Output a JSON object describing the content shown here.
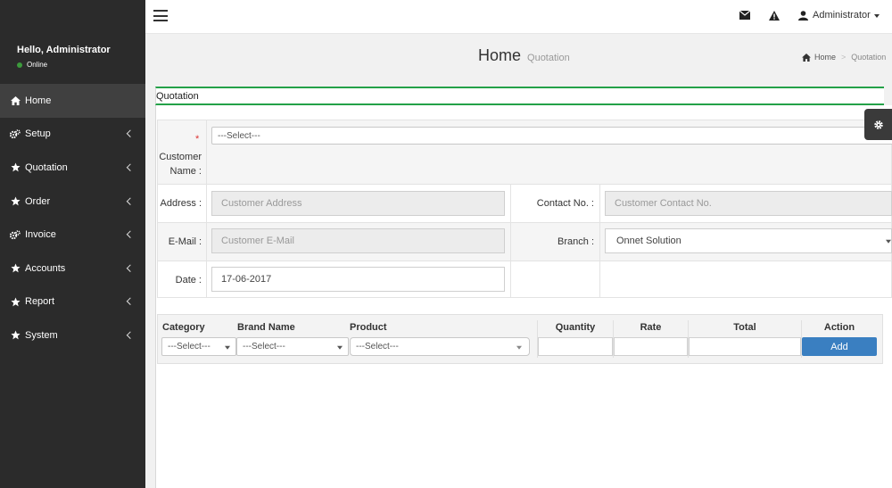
{
  "sidebar": {
    "greeting": "Hello, Administrator",
    "status": "Online",
    "status_color": "#3c9a3c",
    "items": [
      {
        "label": "Home",
        "icon": "home-icon",
        "active": true
      },
      {
        "label": "Setup",
        "icon": "cogs-icon"
      },
      {
        "label": "Quotation",
        "icon": "star-icon"
      },
      {
        "label": "Order",
        "icon": "star-icon"
      },
      {
        "label": "Invoice",
        "icon": "cogs-icon"
      },
      {
        "label": "Accounts",
        "icon": "star-icon"
      },
      {
        "label": "Report",
        "icon": "star-icon"
      },
      {
        "label": "System",
        "icon": "star-icon"
      }
    ]
  },
  "topbar": {
    "user": "Administrator"
  },
  "header": {
    "title": "Home",
    "subtitle": "Quotation",
    "breadcrumb": [
      "Home",
      "Quotation"
    ]
  },
  "box": {
    "title": "Quotation",
    "accent_color": "#24a148"
  },
  "form": {
    "customer_name_label_1": "Customer",
    "customer_name_label_2": "Name :",
    "customer_select": "---Select---",
    "address_label": "Address :",
    "address_placeholder": "Customer Address",
    "contact_label": "Contact No. :",
    "contact_placeholder": "Customer Contact No.",
    "email_label": "E-Mail :",
    "email_placeholder": "Customer E-Mail",
    "branch_label": "Branch :",
    "branch_value": "Onnet Solution",
    "date_label": "Date :",
    "date_value": "17-06-2017"
  },
  "items_table": {
    "headers": {
      "category": "Category",
      "brand": "Brand Name",
      "product": "Product",
      "quantity": "Quantity",
      "rate": "Rate",
      "total": "Total",
      "action": "Action"
    },
    "category_select": "---Select---",
    "brand_select": "---Select---",
    "product_select": "---Select---",
    "add_label": "Add",
    "add_color": "#3a7fc1"
  }
}
